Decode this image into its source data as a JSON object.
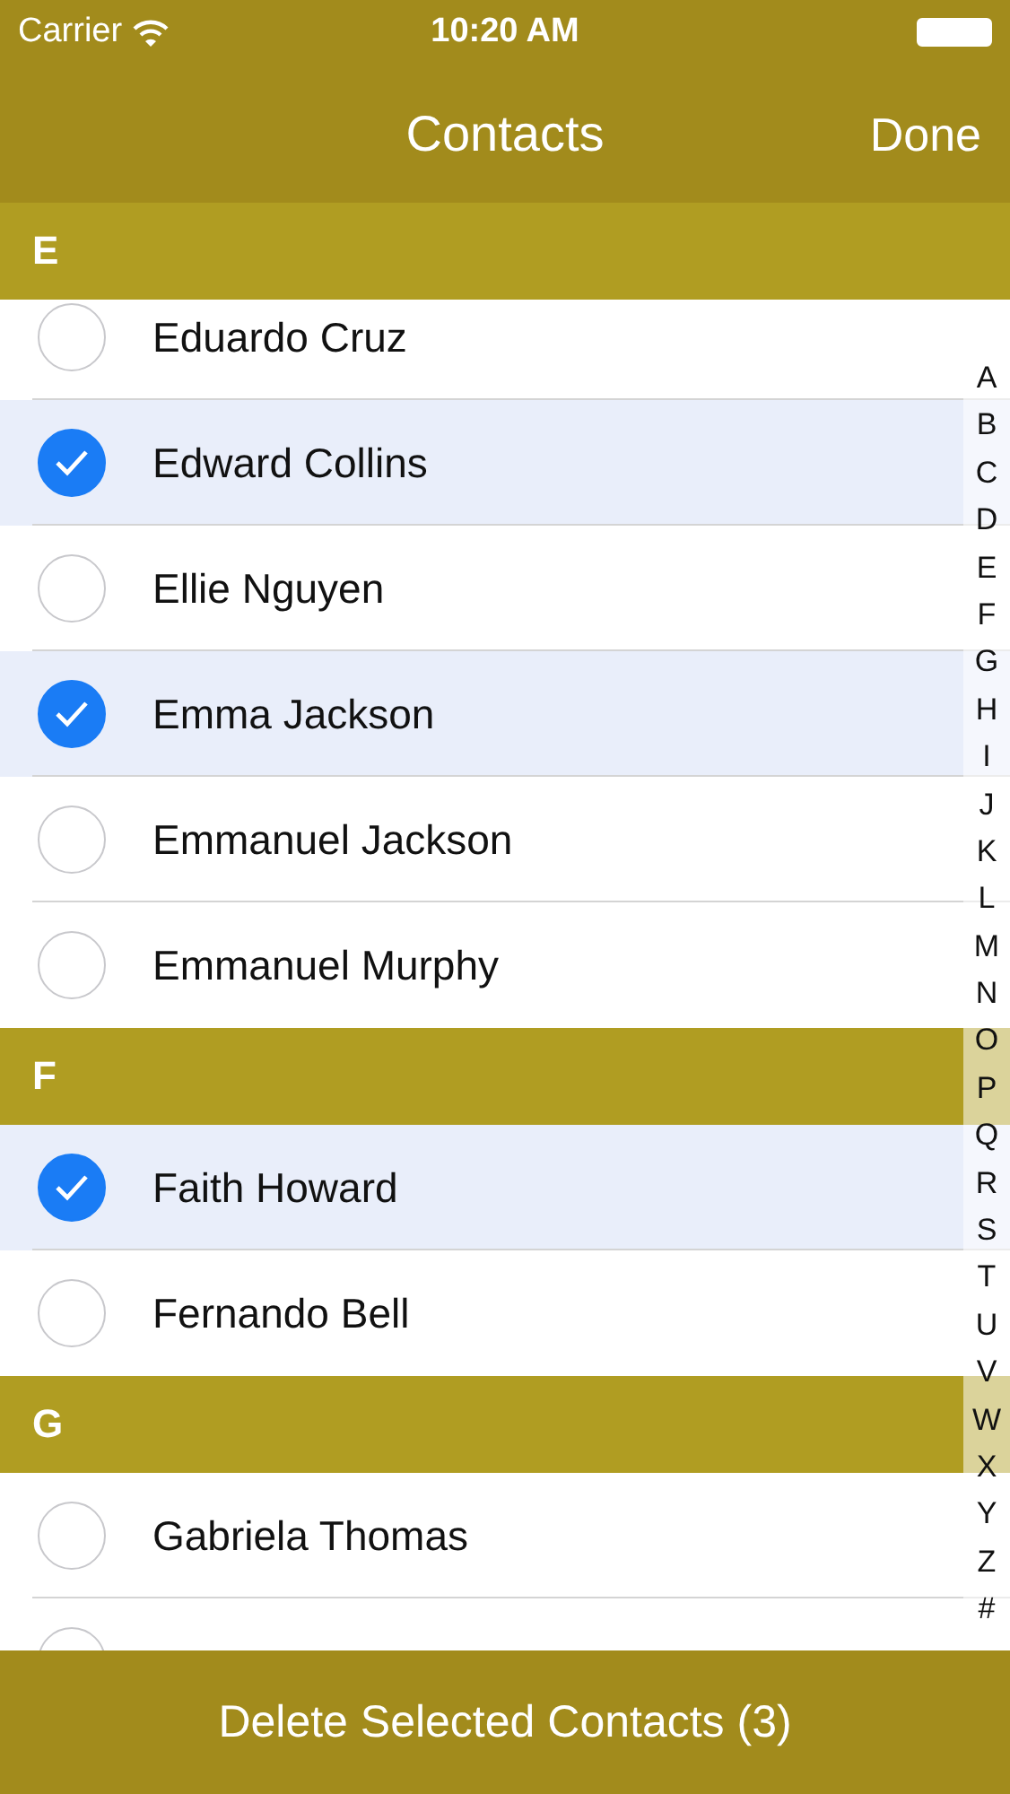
{
  "status_bar": {
    "carrier": "Carrier",
    "time": "10:20 AM"
  },
  "nav_bar": {
    "title": "Contacts",
    "done": "Done"
  },
  "sections": [
    {
      "letter": "E",
      "rows": [
        {
          "name": "Eduardo Cruz",
          "selected": false
        },
        {
          "name": "Edward Collins",
          "selected": true
        },
        {
          "name": "Ellie Nguyen",
          "selected": false
        },
        {
          "name": "Emma Jackson",
          "selected": true
        },
        {
          "name": "Emmanuel Jackson",
          "selected": false
        },
        {
          "name": "Emmanuel Murphy",
          "selected": false
        }
      ]
    },
    {
      "letter": "F",
      "rows": [
        {
          "name": "Faith Howard",
          "selected": true
        },
        {
          "name": "Fernando Bell",
          "selected": false
        }
      ]
    },
    {
      "letter": "G",
      "rows": [
        {
          "name": "Gabriela Thomas",
          "selected": false
        },
        {
          "selected": false
        }
      ]
    }
  ],
  "index": [
    "A",
    "B",
    "C",
    "D",
    "E",
    "F",
    "G",
    "H",
    "I",
    "J",
    "K",
    "L",
    "M",
    "N",
    "O",
    "P",
    "Q",
    "R",
    "S",
    "T",
    "U",
    "V",
    "W",
    "X",
    "Y",
    "Z",
    "#"
  ],
  "delete_button": "Delete Selected Contacts (3)"
}
